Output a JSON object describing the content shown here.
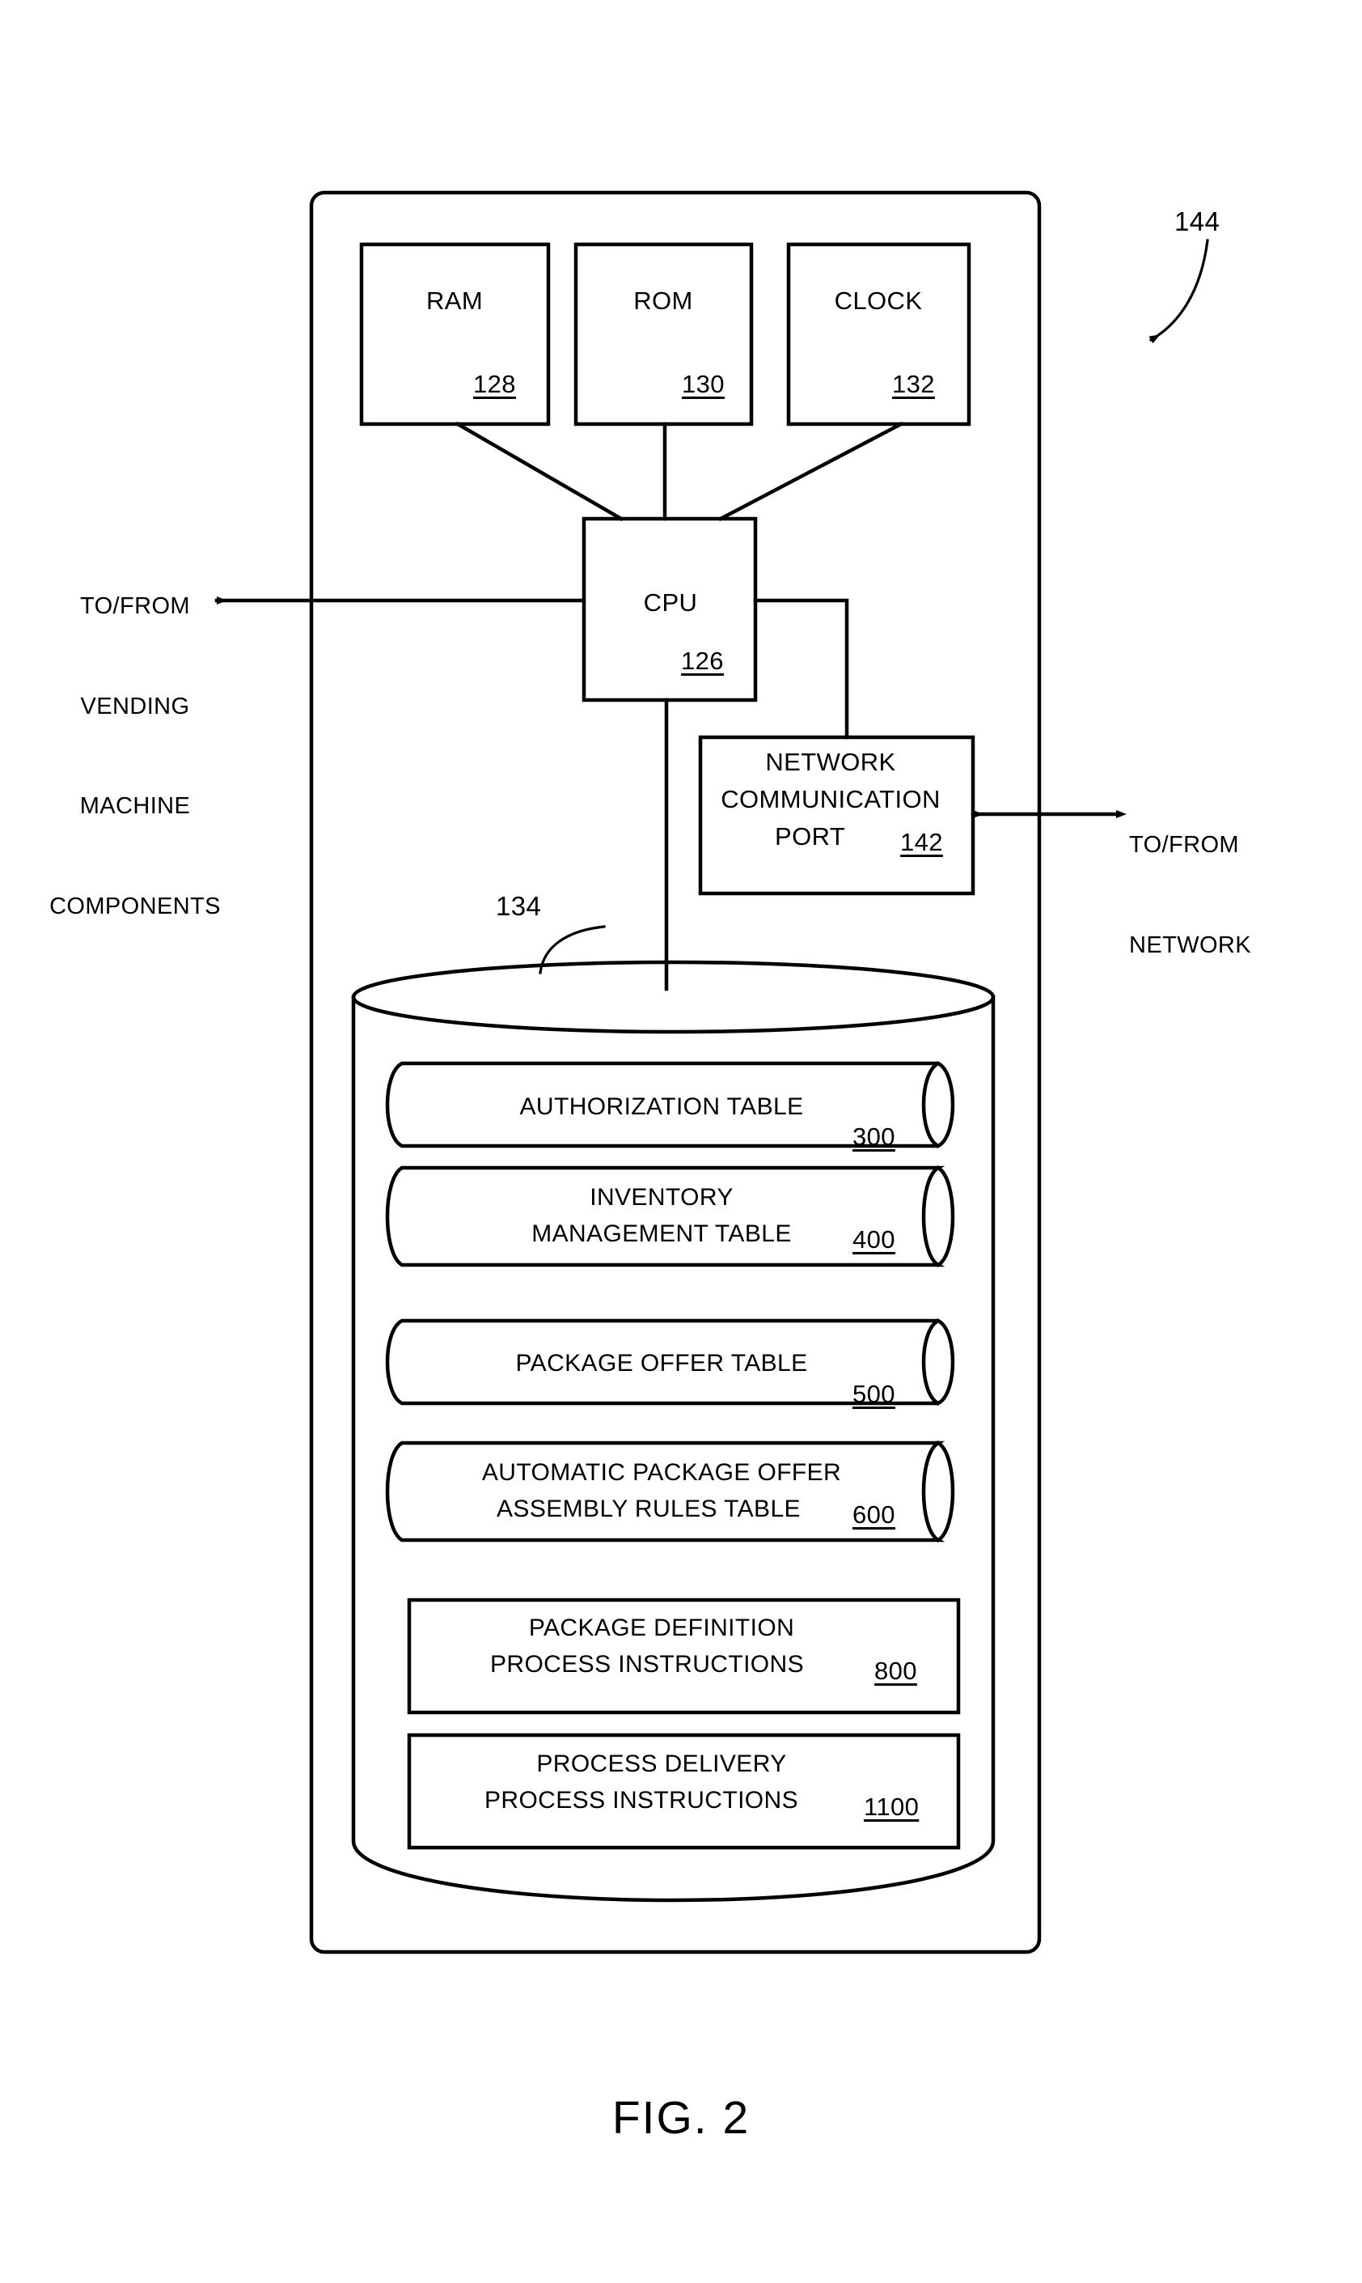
{
  "figure": {
    "caption": "FIG. 2",
    "system_reference": "144",
    "database_reference": "134"
  },
  "external_labels": {
    "left": "TO/FROM\nVENDING\nMACHINE\nCOMPONENTS",
    "left_lines": [
      "TO/FROM",
      "VENDING",
      "MACHINE",
      "COMPONENTS"
    ],
    "right": "TO/FROM\nNETWORK",
    "right_lines": [
      "TO/FROM",
      "NETWORK"
    ]
  },
  "components": {
    "ram": {
      "label": "RAM",
      "ref": "128"
    },
    "rom": {
      "label": "ROM",
      "ref": "130"
    },
    "clock": {
      "label": "CLOCK",
      "ref": "132"
    },
    "cpu": {
      "label": "CPU",
      "ref": "126"
    },
    "network_port": {
      "label_lines": [
        "NETWORK",
        "COMMUNICATION",
        "PORT"
      ],
      "last_line": "PORT",
      "ref": "142"
    }
  },
  "storage": {
    "ref": "134",
    "items": [
      {
        "kind": "cylinder",
        "lines": [
          "AUTHORIZATION TABLE"
        ],
        "ref": "300"
      },
      {
        "kind": "cylinder",
        "lines": [
          "INVENTORY",
          "MANAGEMENT TABLE"
        ],
        "ref": "400"
      },
      {
        "kind": "cylinder",
        "lines": [
          "PACKAGE OFFER TABLE"
        ],
        "ref": "500"
      },
      {
        "kind": "cylinder",
        "lines": [
          "AUTOMATIC PACKAGE OFFER",
          "ASSEMBLY RULES TABLE"
        ],
        "ref": "600"
      },
      {
        "kind": "rect",
        "lines": [
          "PACKAGE DEFINITION",
          "PROCESS INSTRUCTIONS"
        ],
        "ref": "800"
      },
      {
        "kind": "rect",
        "lines": [
          "PROCESS DELIVERY",
          "PROCESS INSTRUCTIONS"
        ],
        "ref": "1100"
      }
    ]
  },
  "colors": {
    "ink": "#000000",
    "paper": "#ffffff"
  }
}
